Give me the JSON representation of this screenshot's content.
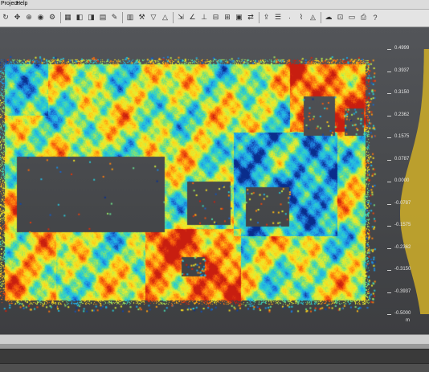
{
  "menu": {
    "items": [
      "Project",
      "Help"
    ]
  },
  "toolbar": {
    "icons": [
      "rotate-icon",
      "pan-icon",
      "zoom-icon",
      "navigate-icon",
      "settings-icon",
      "color-icon",
      "display-icon",
      "snapshot-icon",
      "table-icon",
      "edit-icon",
      "layers-icon",
      "tool-icon",
      "filter-icon",
      "measure-icon",
      "distance-icon",
      "angle-icon",
      "normal-icon",
      "cross-section-icon",
      "profile-icon",
      "volume-icon",
      "compare-icon",
      "export-icon",
      "report-icon",
      "point-icon",
      "segment-icon",
      "mesh-icon",
      "cloud-icon",
      "view-icon",
      "save-icon",
      "print-icon",
      "help-icon"
    ]
  },
  "scale": {
    "ticks": [
      "0.4999",
      "0.3937",
      "0.3150",
      "0.2362",
      "0.1575",
      "0.0787",
      "0.0000",
      "-0.0787",
      "-0.1575",
      "-0.2362",
      "-0.3150",
      "-0.3937",
      "-0.5000"
    ],
    "unit": "m",
    "colormap": [
      "#0a2d8c",
      "#1d6fd6",
      "#22b3e8",
      "#2fd2c8",
      "#8be36a",
      "#e6ef30",
      "#ffd21a",
      "#ff8c10",
      "#f04d0e",
      "#c81e10"
    ]
  },
  "colors": {
    "background_top": "#535559",
    "background_bottom": "#3d3e41",
    "void": "#5a5b5e"
  }
}
